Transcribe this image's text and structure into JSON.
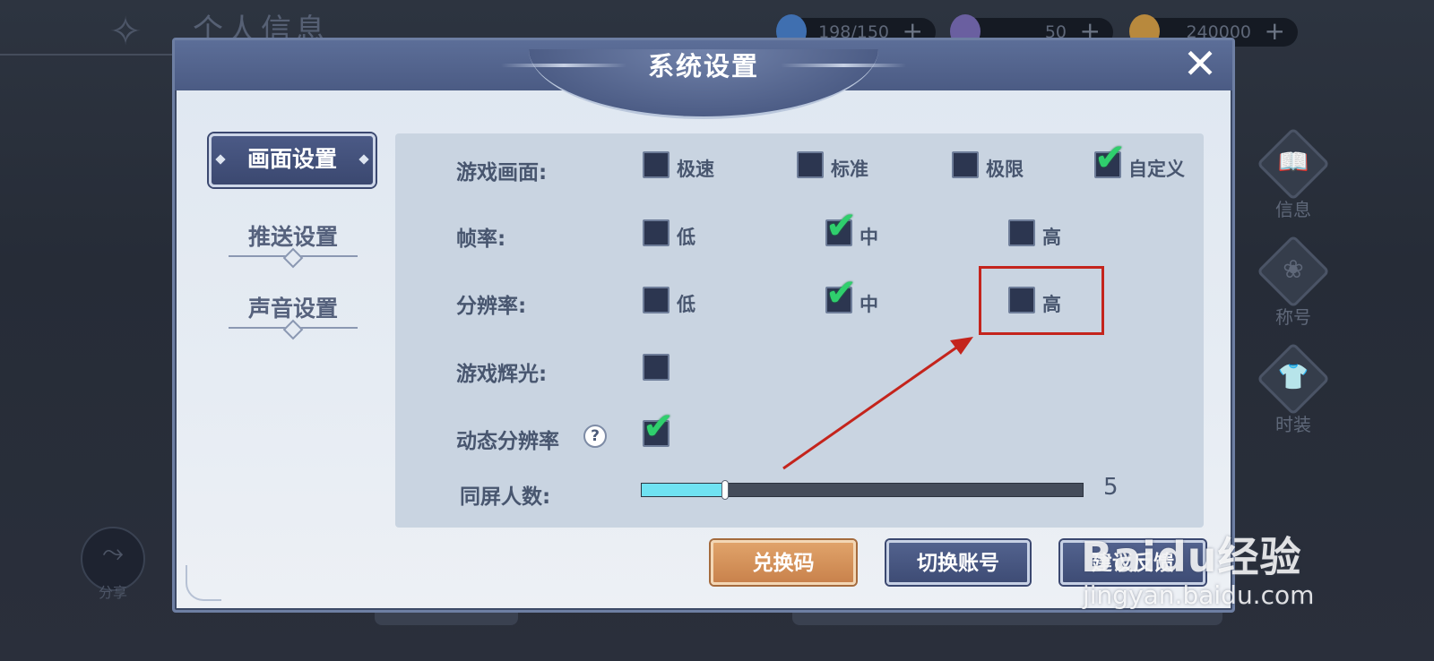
{
  "background": {
    "page_title": "个人信息",
    "resources": [
      {
        "value": "198/150",
        "plus": "+",
        "color": "#3f6fb0"
      },
      {
        "value": "50",
        "plus": "+",
        "color": "#6a5fa0"
      },
      {
        "value": "240000",
        "plus": "+",
        "color": "#b8893d"
      }
    ],
    "side_buttons": [
      {
        "label": "信息",
        "glyph": "📖"
      },
      {
        "label": "称号",
        "glyph": "❀"
      },
      {
        "label": "时装",
        "glyph": "👕"
      }
    ],
    "share": {
      "label": "分享",
      "glyph": "⤳"
    }
  },
  "dialog": {
    "title": "系统设置",
    "close": "✕",
    "tabs": [
      {
        "label": "画面设置",
        "active": true
      },
      {
        "label": "推送设置",
        "active": false
      },
      {
        "label": "声音设置",
        "active": false
      }
    ],
    "settings": {
      "game_graphics": {
        "label": "游戏画面:",
        "options": [
          {
            "label": "极速",
            "checked": false
          },
          {
            "label": "标准",
            "checked": false
          },
          {
            "label": "极限",
            "checked": false
          },
          {
            "label": "自定义",
            "checked": true
          }
        ]
      },
      "frame_rate": {
        "label": "帧率:",
        "options": [
          {
            "label": "低",
            "checked": false
          },
          {
            "label": "中",
            "checked": true
          },
          {
            "label": "高",
            "checked": false
          }
        ]
      },
      "resolution": {
        "label": "分辨率:",
        "options": [
          {
            "label": "低",
            "checked": false
          },
          {
            "label": "中",
            "checked": true
          },
          {
            "label": "高",
            "checked": false
          }
        ]
      },
      "bloom": {
        "label": "游戏辉光:",
        "checked": false
      },
      "dynamic_resolution": {
        "label": "动态分辨率",
        "help": "?",
        "checked": true
      },
      "players_on_screen": {
        "label": "同屏人数:",
        "value": "5",
        "fill_fraction": 0.19
      }
    },
    "buttons": {
      "redeem": "兑换码",
      "switch_account": "切换账号",
      "feedback": "建议反馈"
    }
  },
  "check_mark": "✔",
  "watermark": {
    "brand": "Baidu经验",
    "url": "jingyan.baidu.com"
  },
  "colors": {
    "check": "#2fcf6d",
    "annotation": "#c4241c",
    "slider_fill": "#6fe2f2"
  }
}
